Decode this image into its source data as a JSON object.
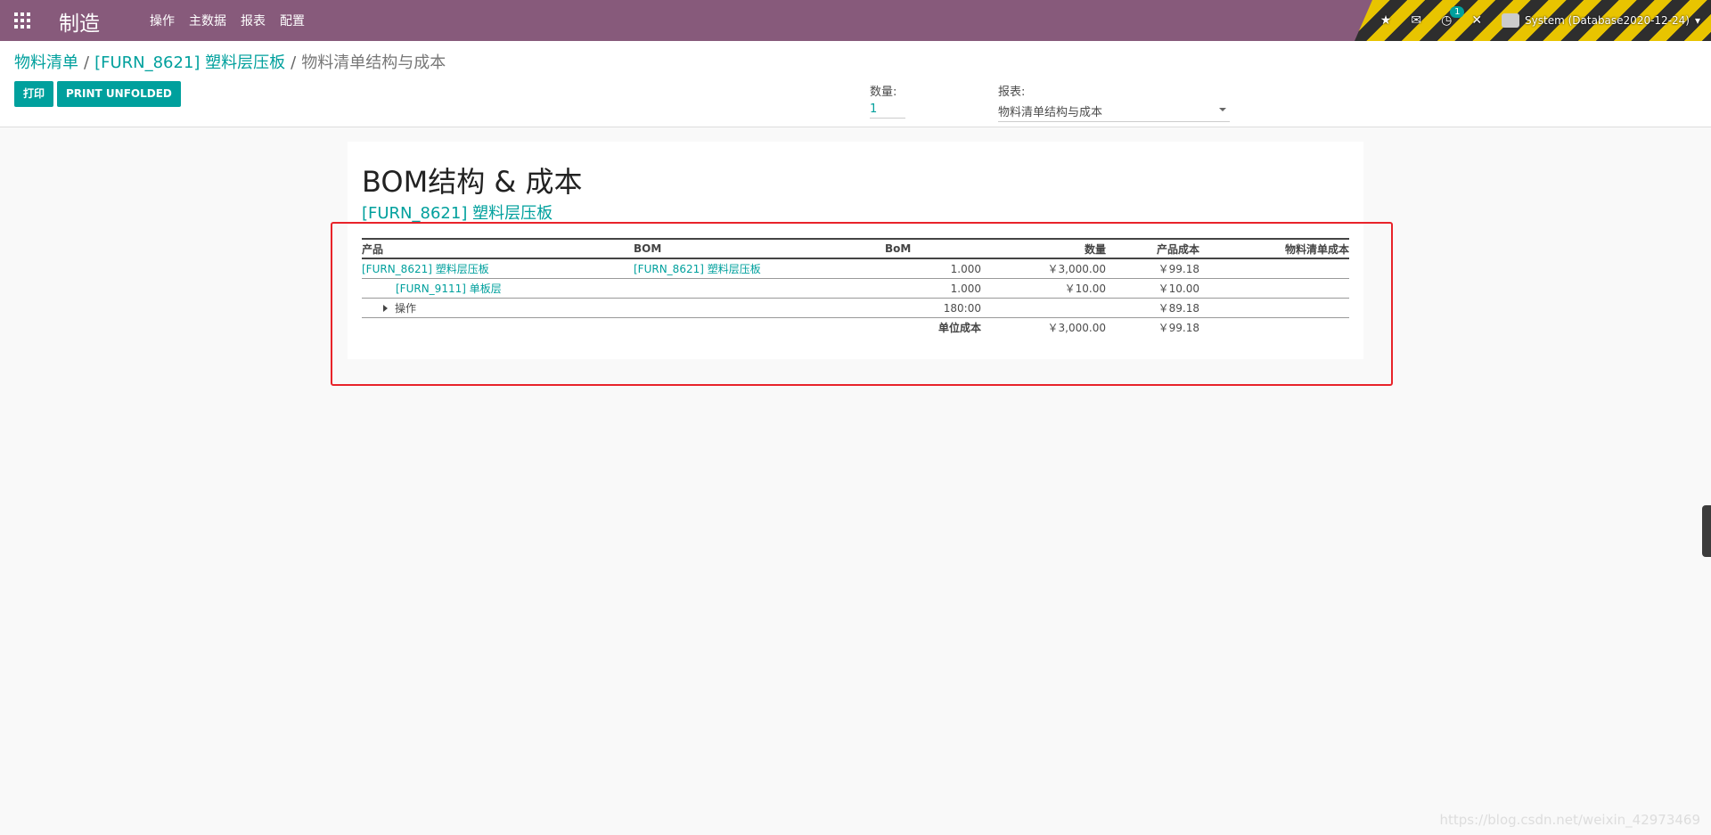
{
  "navbar": {
    "app_name": "制造",
    "menu": [
      "操作",
      "主数据",
      "报表",
      "配置"
    ],
    "activity_count": "1",
    "user": "System (Database2020-12-24)",
    "accent": "#875a7b"
  },
  "breadcrumb": {
    "root": "物料清单",
    "product": "[FURN_8621] 塑料层压板",
    "current": "物料清单结构与成本"
  },
  "buttons": {
    "print": "打印",
    "print_unfolded": "PRINT UNFOLDED"
  },
  "quantity": {
    "label": "数量:",
    "value": "1"
  },
  "report_select": {
    "label": "报表:",
    "value": "物料清单结构与成本"
  },
  "report": {
    "title": "BOM结构 & 成本",
    "subtitle": "[FURN_8621] 塑料层压板",
    "headers": {
      "product": "产品",
      "bom": "BOM",
      "bom_qty": "BoM",
      "quantity": "数量",
      "product_cost": "产品成本",
      "bom_cost": "物料清单成本"
    },
    "rows": [
      {
        "product": "[FURN_8621] 塑料层压板",
        "bom": "[FURN_8621] 塑料层压板",
        "bom_qty": "1.000",
        "quantity": "￥3,000.00",
        "product_cost": "￥99.18",
        "bom_cost": ""
      },
      {
        "product": "[FURN_9111] 单板层",
        "bom": "",
        "bom_qty": "1.000",
        "quantity": "￥10.00",
        "product_cost": "￥10.00",
        "bom_cost": ""
      },
      {
        "product": "操作",
        "bom": "",
        "bom_qty": "180:00",
        "quantity": "",
        "product_cost": "￥89.18",
        "bom_cost": ""
      }
    ],
    "total": {
      "label": "单位成本",
      "quantity": "￥3,000.00",
      "product_cost": "￥99.18"
    }
  },
  "watermark": "https://blog.csdn.net/weixin_42973469"
}
